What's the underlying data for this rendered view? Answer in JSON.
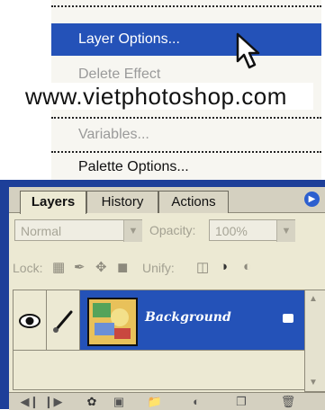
{
  "context_menu": {
    "items": [
      {
        "label": "Layer Options...",
        "state": "highlighted"
      },
      {
        "label": "Delete Effect",
        "state": "disabled"
      },
      {
        "label": "Variables...",
        "state": "disabled"
      },
      {
        "label": "Palette Options...",
        "state": "enabled"
      }
    ]
  },
  "watermark": "www.vietphotoshop.com",
  "palette": {
    "tabs": [
      {
        "label": "Layers",
        "active": true
      },
      {
        "label": "History",
        "active": false
      },
      {
        "label": "Actions",
        "active": false
      }
    ],
    "blend_mode": "Normal",
    "opacity_label": "Opacity:",
    "opacity_value": "100%",
    "lock_label": "Lock:",
    "unify_label": "Unify:",
    "layers": [
      {
        "name": "Background",
        "visible": true,
        "selected": true,
        "locked": true
      }
    ]
  },
  "colors": {
    "highlight": "#2452b8",
    "panel": "#ece9d3",
    "window_blue": "#1d3f99"
  }
}
